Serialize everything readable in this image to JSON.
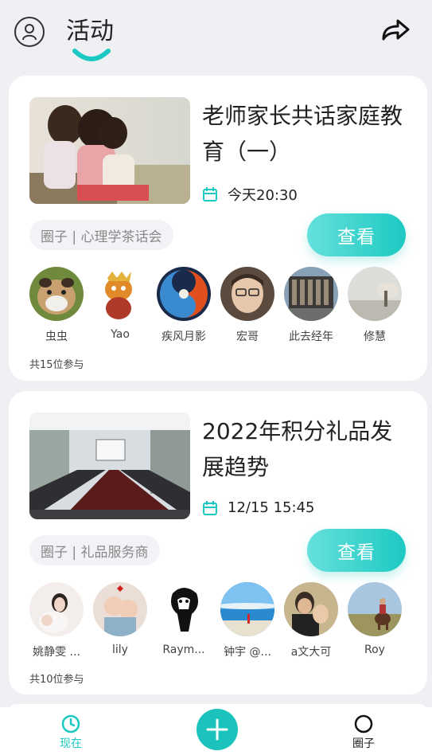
{
  "header": {
    "title": "活动",
    "accent": "#1cc9c2"
  },
  "events": [
    {
      "title": "老师家长共话家庭教育（一）",
      "time": "今天20:30",
      "circle": "圈子 | 心理学茶话会",
      "view_label": "查看",
      "participants_text": "共15位参与",
      "avatars": [
        "虫虫⁣",
        "Yao",
        "疾风月影",
        "宏哥",
        "此去经年",
        "修慧"
      ]
    },
    {
      "title": "2022年积分礼品发展趋势",
      "time": "12/15 15:45",
      "circle": "圈子 | 礼品服务商",
      "view_label": "查看",
      "participants_text": "共10位参与",
      "avatars": [
        "姚静雯 ...",
        "lily",
        "Raym...",
        "钟宇 @...",
        "a文大可",
        "Roy"
      ]
    }
  ],
  "bottom_nav": {
    "now_label": "现在",
    "circle_label": "圈子"
  },
  "icons": [
    "profile-icon",
    "share-icon",
    "calendar-icon",
    "clock-icon",
    "plus-icon",
    "circle-icon"
  ]
}
